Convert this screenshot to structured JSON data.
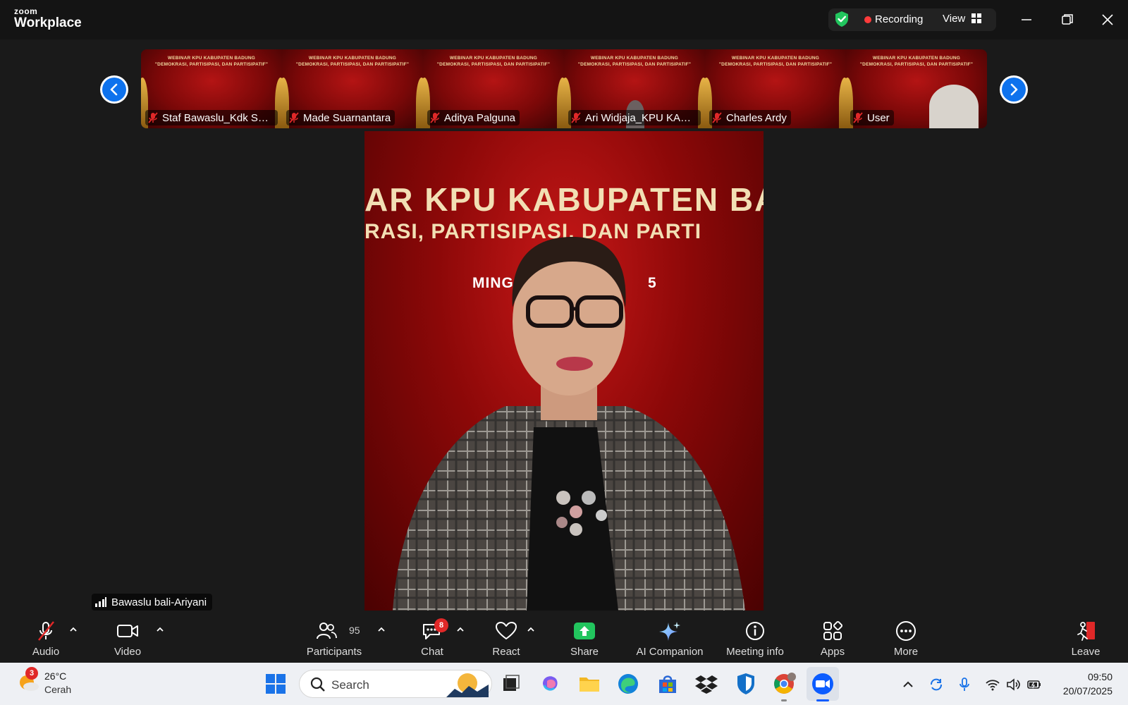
{
  "app": {
    "brand_small": "zoom",
    "brand_large": "Workplace"
  },
  "titlebar": {
    "recording_label": "Recording",
    "view_label": "View"
  },
  "thumbnails": [
    {
      "name": "Staf Bawaslu_Kdk Suar..."
    },
    {
      "name": "Made Suarnantara"
    },
    {
      "name": "Aditya Palguna"
    },
    {
      "name": "Ari Widjaja_KPU KABU..."
    },
    {
      "name": "Charles Ardy"
    },
    {
      "name": "User"
    }
  ],
  "thumbnail_banner": {
    "line1": "WEBINAR KPU KABUPATEN BADUNG",
    "line2": "\"DEMOKRASI, PARTISIPASI, DAN PARTISIPATIF\""
  },
  "main_video": {
    "line1": "AR KPU KABUPATEN BA",
    "line2": "RASI, PARTISIPASI, DAN PARTI",
    "line3a": "MINGGU",
    "line3b": "5",
    "speaker": "Bawaslu bali-Ariyani"
  },
  "toolbar": {
    "audio": "Audio",
    "video": "Video",
    "participants": "Participants",
    "participant_count": "95",
    "chat": "Chat",
    "chat_badge": "8",
    "react": "React",
    "share": "Share",
    "ai_companion": "AI Companion",
    "meeting_info": "Meeting info",
    "apps": "Apps",
    "more": "More",
    "leave": "Leave"
  },
  "taskbar": {
    "weather_badge": "3",
    "temperature": "26°C",
    "condition": "Cerah",
    "search_placeholder": "Search",
    "time": "09:50",
    "date": "20/07/2025"
  },
  "colors": {
    "accent": "#0e72ed",
    "share_green": "#22c55e",
    "recording_red": "#ff3b3b",
    "badge_red": "#e02828"
  }
}
